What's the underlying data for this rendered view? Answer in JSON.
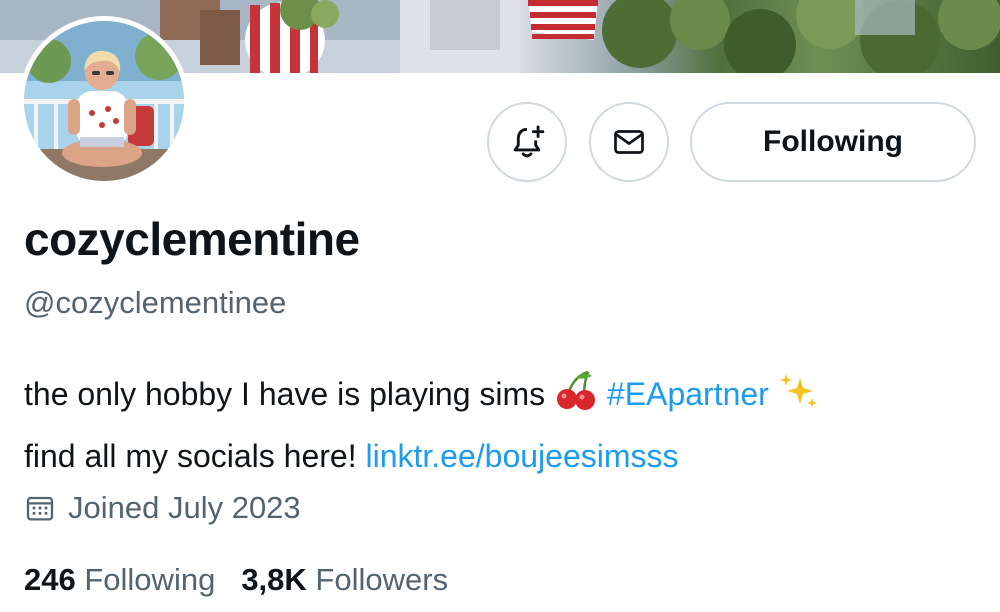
{
  "profile": {
    "display_name": "cozyclementine",
    "handle": "@cozyclementinee",
    "bio_line1_text": "the only hobby I have is playing sims",
    "bio_emoji_cherry": "🍒",
    "bio_hashtag": "#EApartner",
    "bio_emoji_sparkles": "✨",
    "bio_line2_text": "find all my socials here!",
    "bio_link": "linktr.ee/boujeesimsss",
    "joined": "Joined July 2023"
  },
  "actions": {
    "notify_icon": "bell-plus-icon",
    "message_icon": "envelope-icon",
    "following_label": "Following"
  },
  "stats": {
    "following_count": "246",
    "following_label": "Following",
    "followers_count": "3,8K",
    "followers_label": "Followers"
  },
  "colors": {
    "accent": "#1d9bf0",
    "text_primary": "#0f1419",
    "text_secondary": "#536471",
    "border": "#cfd9de"
  }
}
